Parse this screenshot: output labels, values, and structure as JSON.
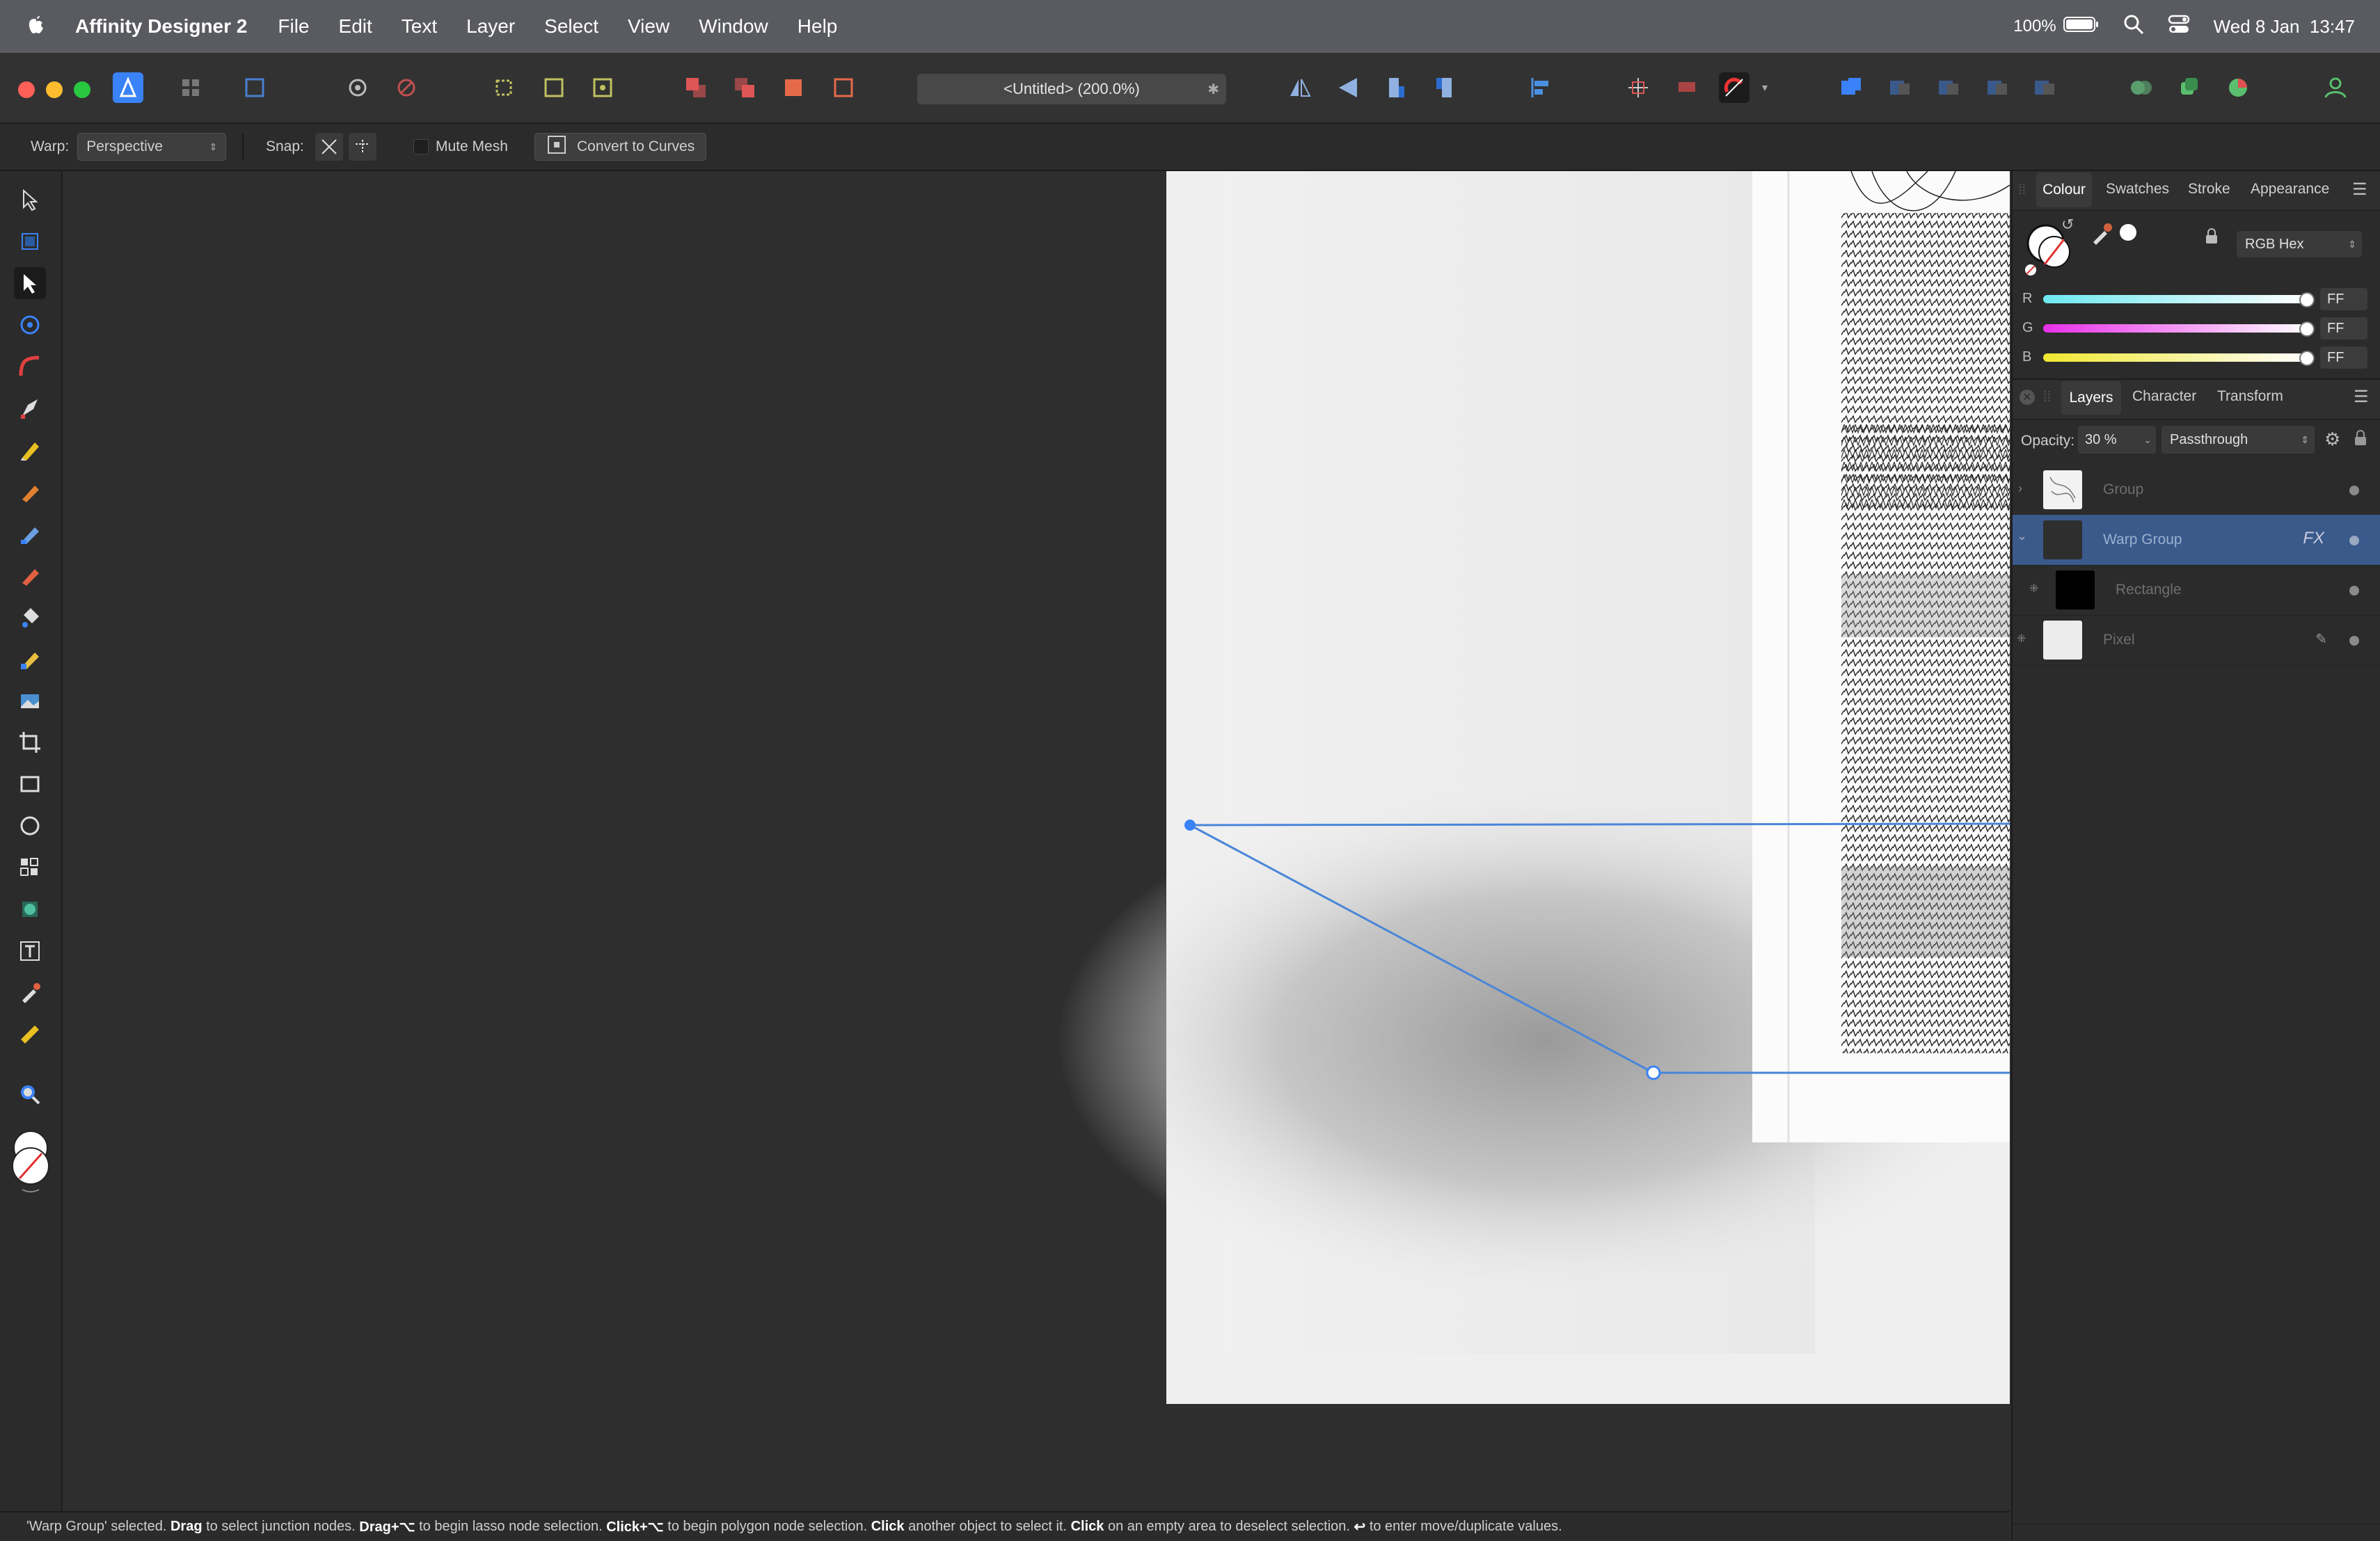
{
  "menubar": {
    "app_name": "Affinity Designer 2",
    "items": [
      "File",
      "Edit",
      "Text",
      "Layer",
      "Select",
      "View",
      "Window",
      "Help"
    ],
    "battery": "100%",
    "clock": "Wed 8 Jan  13:47"
  },
  "document": {
    "title": "<Untitled> (200.0%)"
  },
  "context_toolbar": {
    "warp_label": "Warp:",
    "warp_value": "Perspective",
    "snap_label": "Snap:",
    "mute_mesh_label": "Mute Mesh",
    "convert_label": "Convert to Curves"
  },
  "colour_panel": {
    "tabs": [
      "Colour",
      "Swatches",
      "Stroke",
      "Appearance"
    ],
    "active_tab": "Colour",
    "model": "RGB Hex",
    "channels": [
      {
        "label": "R",
        "value": "FF"
      },
      {
        "label": "G",
        "value": "FF"
      },
      {
        "label": "B",
        "value": "FF"
      }
    ]
  },
  "layers_panel": {
    "tabs": [
      "Layers",
      "Character",
      "Transform"
    ],
    "active_tab": "Layers",
    "opacity_label": "Opacity:",
    "opacity_value": "30 %",
    "blend_mode": "Passthrough",
    "layers": [
      {
        "name": "Group",
        "selected": false
      },
      {
        "name": "Warp Group",
        "selected": true,
        "fx": "FX"
      },
      {
        "name": "Rectangle",
        "selected": false
      },
      {
        "name": "Pixel",
        "selected": false
      }
    ]
  },
  "status_bar": {
    "p1": "'Warp Group' selected. ",
    "b1": "Drag",
    "p2": " to select junction nodes. ",
    "b2": "Drag+⌥",
    "p3": " to begin lasso node selection. ",
    "b3": "Click+⌥",
    "p4": " to begin polygon node selection. ",
    "b4": "Click",
    "p5": " another object to select it. ",
    "b5": "Click",
    "p6": " on an empty area to deselect selection. ",
    "b6": "↩",
    "p7": " to enter move/duplicate values."
  },
  "colors": {
    "accent": "#3a82f7",
    "selection_row": "#3a5a8c",
    "warp_line": "#4a86d8"
  }
}
